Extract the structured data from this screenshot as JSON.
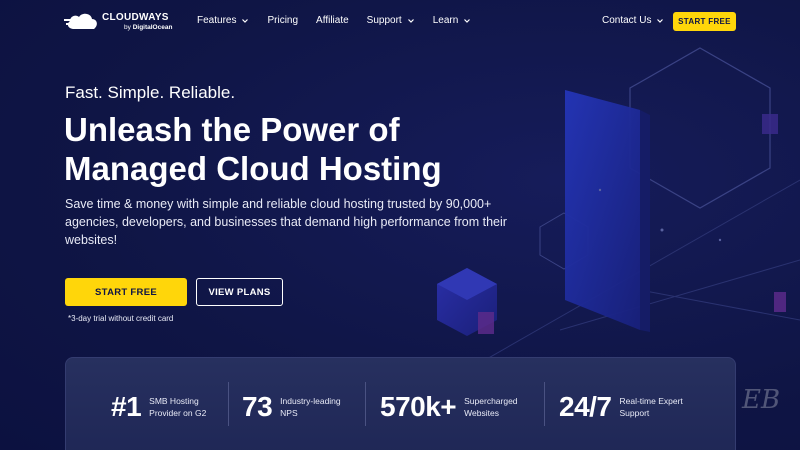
{
  "brand": {
    "name": "CLOUDWAYS",
    "by": "by",
    "owner": "DigitalOcean"
  },
  "nav": {
    "items": [
      {
        "label": "Features",
        "has_dropdown": true
      },
      {
        "label": "Pricing",
        "has_dropdown": false
      },
      {
        "label": "Affiliate",
        "has_dropdown": false
      },
      {
        "label": "Support",
        "has_dropdown": true
      },
      {
        "label": "Learn",
        "has_dropdown": true
      }
    ],
    "contact_label": "Contact Us",
    "start_free_label": "START FREE"
  },
  "hero": {
    "tagline": "Fast. Simple. Reliable.",
    "headline_line1": "Unleash the Power of",
    "headline_line2": "Managed Cloud Hosting",
    "description": "Save time & money with simple and reliable cloud hosting trusted by 90,000+ agencies, developers, and businesses that demand high performance from their websites!",
    "primary_cta": "START FREE",
    "secondary_cta": "VIEW PLANS",
    "trial_note": "*3-day trial without credit card"
  },
  "stats": [
    {
      "value": "#1",
      "label": "SMB Hosting Provider on G2"
    },
    {
      "value": "73",
      "label": "Industry-leading NPS"
    },
    {
      "value": "570k+",
      "label": "Supercharged Websites"
    },
    {
      "value": "24/7",
      "label": "Real-time Expert Support"
    }
  ],
  "watermark": "EB",
  "colors": {
    "background": "#0f1545",
    "accent_yellow": "#ffd60a",
    "stats_panel": "#27305f",
    "cube_blue": "#1d2a9e"
  },
  "icons": {
    "logo": "cloud-logo-icon",
    "dropdown": "chevron-down-icon"
  }
}
